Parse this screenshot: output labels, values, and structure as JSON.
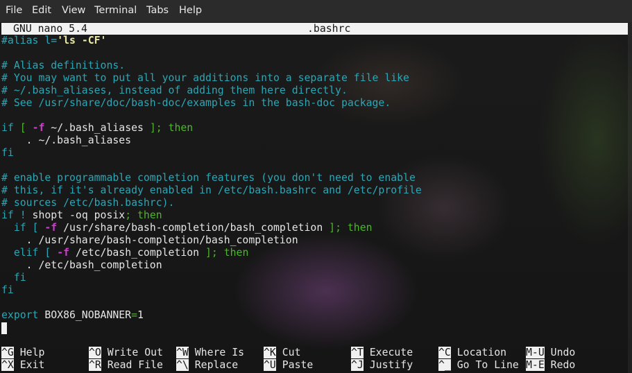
{
  "menubar": {
    "items": [
      {
        "label": "File"
      },
      {
        "label": "Edit"
      },
      {
        "label": "View"
      },
      {
        "label": "Terminal"
      },
      {
        "label": "Tabs"
      },
      {
        "label": "Help"
      }
    ]
  },
  "nano": {
    "version": "GNU nano 5.4",
    "filename": ".bashrc"
  },
  "editor": {
    "l1a": "#alias l=",
    "l1b": "'ls -CF'",
    "l3": "# Alias definitions.",
    "l4": "# You may want to put all your additions into a separate file like",
    "l5": "# ~/.bash_aliases, instead of adding them here directly.",
    "l6": "# See /usr/share/doc/bash-doc/examples in the bash-doc package.",
    "l8a": "if",
    "l8b": " [ ",
    "l8c": "-f",
    "l8d": " ~/.bash_aliases ",
    "l8e": "]; then",
    "l9": "    . ~/.bash_aliases",
    "l10": "fi",
    "l12": "# enable programmable completion features (you don't need to enable",
    "l13": "# this, if it's already enabled in /etc/bash.bashrc and /etc/profile",
    "l14": "# sources /etc/bash.bashrc).",
    "l15a": "if ! ",
    "l15b": "shopt -oq posix",
    "l15c": "; then",
    "l16a": "  if [ ",
    "l16b": "-f",
    "l16c": " /usr/share/bash-completion/bash_completion ",
    "l16d": "]; then",
    "l17": "    . /usr/share/bash-completion/bash_completion",
    "l18a": "  elif [ ",
    "l18b": "-f",
    "l18c": " /etc/bash_completion ",
    "l18d": "]; then",
    "l19": "    . /etc/bash_completion",
    "l20": "  fi",
    "l21": "fi",
    "l23a": "export",
    "l23b": " BOX86_NOBANNER",
    "l23c": "=",
    "l23d": "1"
  },
  "shortcuts": [
    {
      "key": "^G",
      "label": "Help"
    },
    {
      "key": "^X",
      "label": "Exit"
    },
    {
      "key": "^O",
      "label": "Write Out"
    },
    {
      "key": "^R",
      "label": "Read File"
    },
    {
      "key": "^W",
      "label": "Where Is"
    },
    {
      "key": "^\\",
      "label": "Replace"
    },
    {
      "key": "^K",
      "label": "Cut"
    },
    {
      "key": "^U",
      "label": "Paste"
    },
    {
      "key": "^T",
      "label": "Execute"
    },
    {
      "key": "^J",
      "label": "Justify"
    },
    {
      "key": "^C",
      "label": "Location"
    },
    {
      "key": "^_",
      "label": "Go To Line"
    },
    {
      "key": "M-U",
      "label": "Undo"
    },
    {
      "key": "M-E",
      "label": "Redo"
    }
  ]
}
